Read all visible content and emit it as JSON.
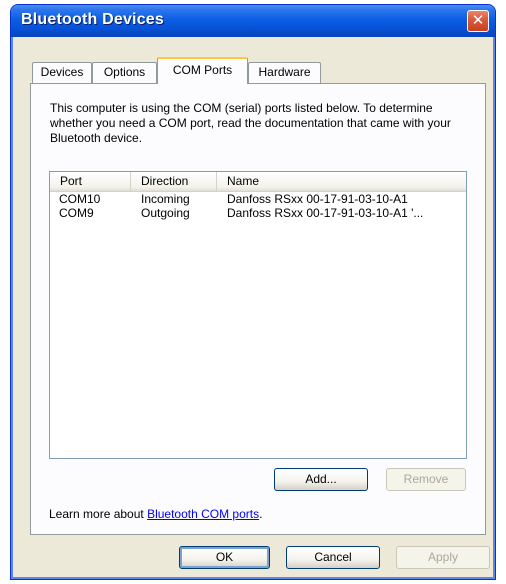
{
  "window": {
    "title": "Bluetooth Devices",
    "close_label": "✕"
  },
  "tabs": [
    {
      "label": "Devices",
      "active": false
    },
    {
      "label": "Options",
      "active": false
    },
    {
      "label": "COM Ports",
      "active": true
    },
    {
      "label": "Hardware",
      "active": false
    }
  ],
  "com_ports": {
    "description": "This computer is using the COM (serial) ports listed below. To determine whether you need a COM port, read the documentation that came with your Bluetooth device.",
    "columns": [
      "Port",
      "Direction",
      "Name"
    ],
    "rows": [
      {
        "port": "COM10",
        "direction": "Incoming",
        "name": "Danfoss RSxx 00-17-91-03-10-A1"
      },
      {
        "port": "COM9",
        "direction": "Outgoing",
        "name": "Danfoss RSxx 00-17-91-03-10-A1 '..."
      }
    ],
    "add_label": "Add...",
    "remove_label": "Remove",
    "learn_prefix": "Learn more about ",
    "learn_link": "Bluetooth COM ports",
    "learn_suffix": "."
  },
  "footer": {
    "ok_label": "OK",
    "cancel_label": "Cancel",
    "apply_label": "Apply"
  }
}
